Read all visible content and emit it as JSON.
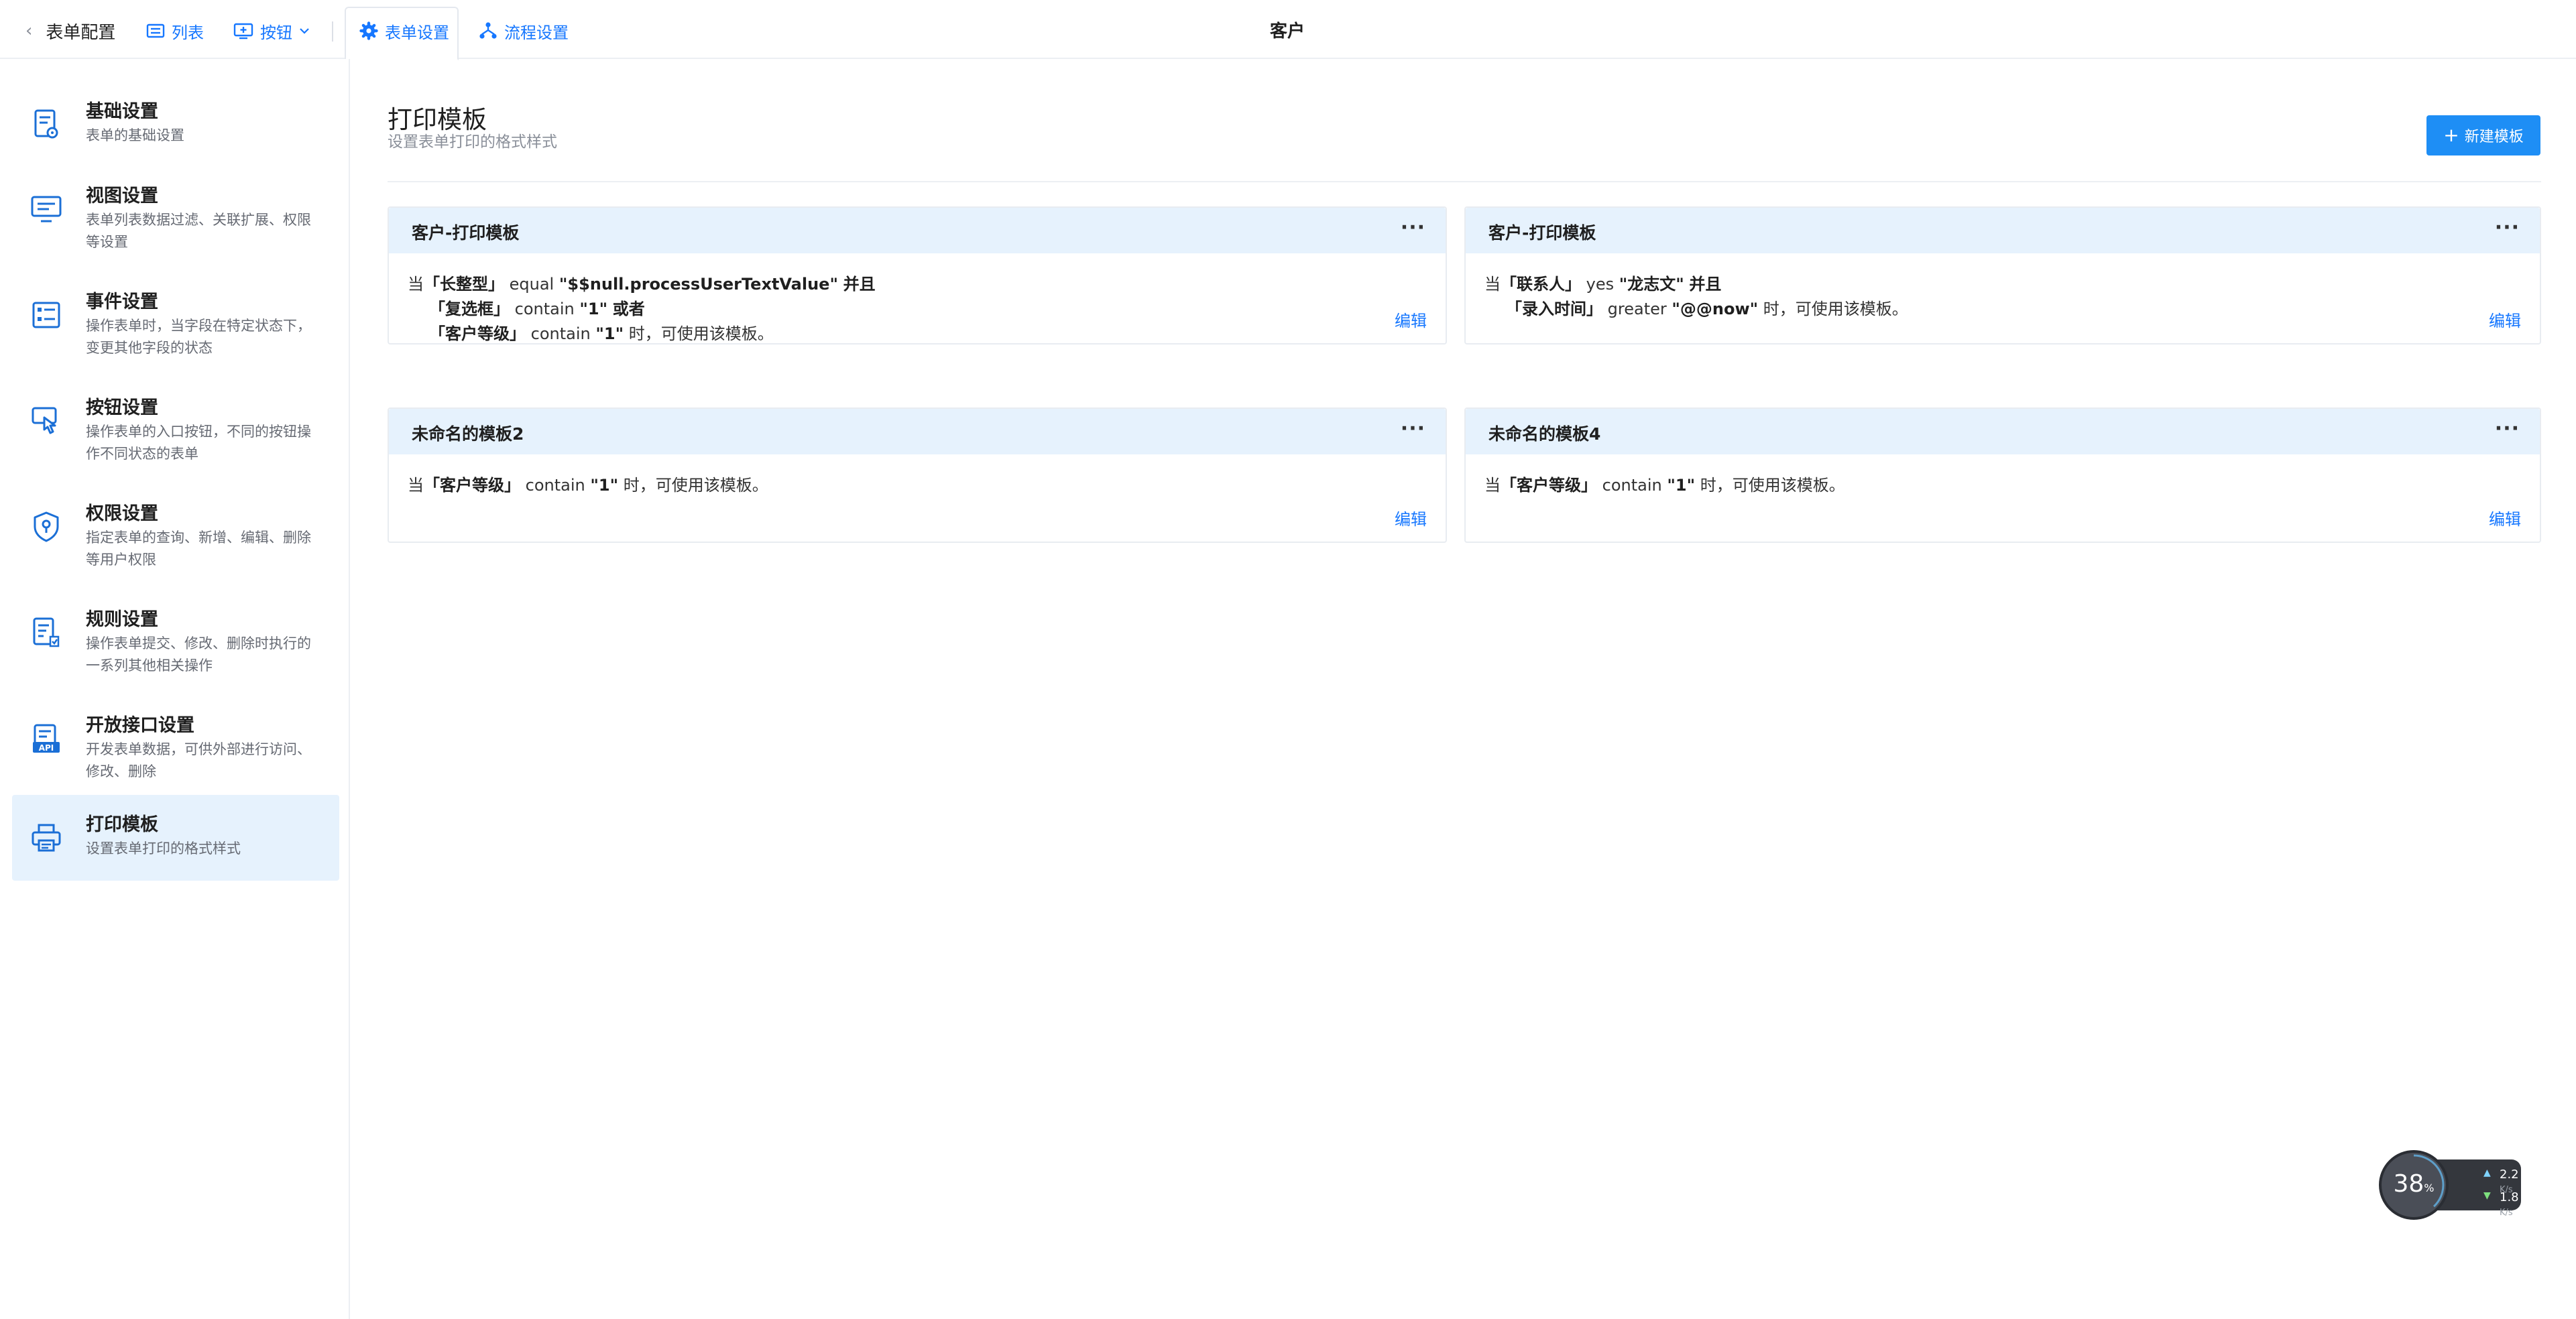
{
  "topbar": {
    "back_label": "表单配置",
    "list_label": "列表",
    "button_label": "按钮",
    "form_settings_tab": "表单设置",
    "flow_settings_tab": "流程设置",
    "center_title": "客户"
  },
  "sidebar": {
    "items": [
      {
        "title": "基础设置",
        "desc": "表单的基础设置",
        "icon": "form-doc-icon"
      },
      {
        "title": "视图设置",
        "desc": "表单列表数据过滤、关联扩展、权限等设置",
        "icon": "monitor-icon"
      },
      {
        "title": "事件设置",
        "desc": "操作表单时，当字段在特定状态下，变更其他字段的状态",
        "icon": "event-list-icon"
      },
      {
        "title": "按钮设置",
        "desc": "操作表单的入口按钮，不同的按钮操作不同状态的表单",
        "icon": "hand-click-icon"
      },
      {
        "title": "权限设置",
        "desc": "指定表单的查询、新增、编辑、删除等用户权限",
        "icon": "shield-icon"
      },
      {
        "title": "规则设置",
        "desc": "操作表单提交、修改、删除时执行的一系列其他相关操作",
        "icon": "rule-doc-icon"
      },
      {
        "title": "开放接口设置",
        "desc": "开发表单数据，可供外部进行访问、修改、删除",
        "icon": "api-icon"
      },
      {
        "title": "打印模板",
        "desc": "设置表单打印的格式样式",
        "icon": "printer-icon"
      }
    ]
  },
  "main": {
    "title": "打印模板",
    "subtitle": "设置表单打印的格式样式",
    "new_button": "新建模板",
    "more_label": "···",
    "edit_label": "编辑",
    "cards": [
      {
        "title": "客户-打印模板",
        "lines": [
          {
            "prefix": "当",
            "field": "「长整型」",
            "op": "equal",
            "value": "\"$$null.processUserTextValue\"",
            "conj": "并且"
          },
          {
            "prefix": "",
            "field": "「复选框」",
            "op": "contain",
            "value": "\"1\"",
            "conj": "或者"
          },
          {
            "prefix": "",
            "field": "「客户等级」",
            "op": "contain",
            "value": "\"1\"",
            "conj": "时，可使用该模板。"
          }
        ]
      },
      {
        "title": "客户-打印模板",
        "lines": [
          {
            "prefix": "当",
            "field": "「联系人」",
            "op": "yes",
            "value": "\"龙志文\"",
            "conj": "并且"
          },
          {
            "prefix": "",
            "field": "「录入时间」",
            "op": "greater",
            "value": "\"@@now\"",
            "conj": "时，可使用该模板。"
          }
        ]
      },
      {
        "title": "未命名的模板2",
        "lines": [
          {
            "prefix": "当",
            "field": "「客户等级」",
            "op": "contain",
            "value": "\"1\"",
            "conj": "时，可使用该模板。"
          }
        ]
      },
      {
        "title": "未命名的模板4",
        "lines": [
          {
            "prefix": "当",
            "field": "「客户等级」",
            "op": "contain",
            "value": "\"1\"",
            "conj": "时，可使用该模板。"
          }
        ]
      }
    ]
  },
  "widget": {
    "percent": "38",
    "percent_unit": "%",
    "upload": "2.2",
    "upload_unit": "K/s",
    "download": "1.8",
    "download_unit": "K/s"
  },
  "colors": {
    "accent": "#1677ff",
    "button": "#1e8ef5",
    "active_bg": "#e6f2fd"
  }
}
